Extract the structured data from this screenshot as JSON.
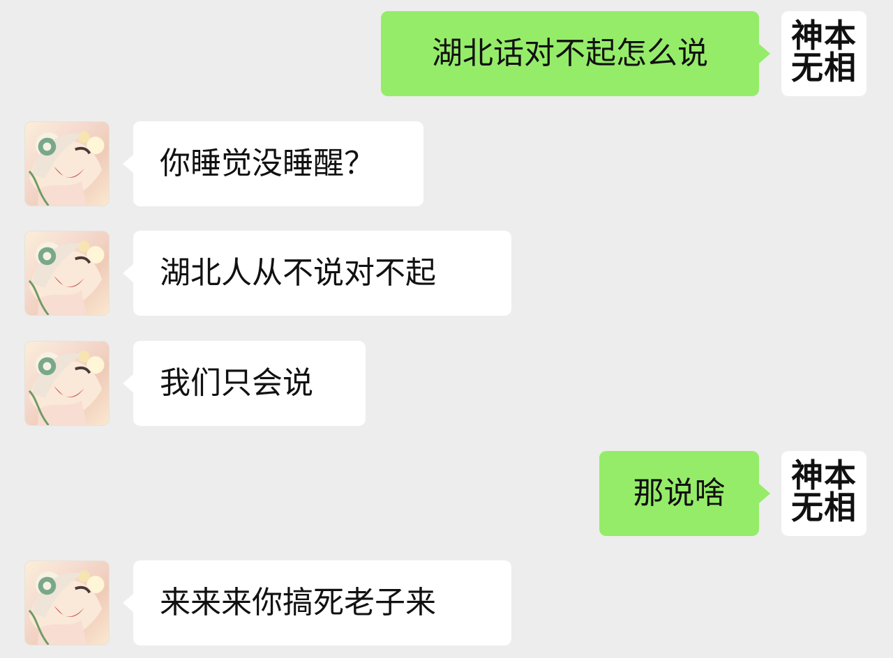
{
  "messages": [
    {
      "side": "right",
      "text": "湖北话对不起怎么说",
      "avatar_text": "神本\n无相"
    },
    {
      "side": "left",
      "text": "你睡觉没睡醒？",
      "avatar_icon": "anime-girl-avatar"
    },
    {
      "side": "left",
      "text": "湖北人从不说对不起",
      "avatar_icon": "anime-girl-avatar"
    },
    {
      "side": "left",
      "text": "我们只会说",
      "avatar_icon": "anime-girl-avatar"
    },
    {
      "side": "right",
      "text": "那说啥",
      "avatar_text": "神本\n无相"
    },
    {
      "side": "left",
      "text": "来来来你搞死老子来",
      "avatar_icon": "anime-girl-avatar"
    }
  ],
  "colors": {
    "background": "#ededed",
    "incoming_bubble": "#ffffff",
    "outgoing_bubble": "#95ec69",
    "text": "#111111"
  }
}
